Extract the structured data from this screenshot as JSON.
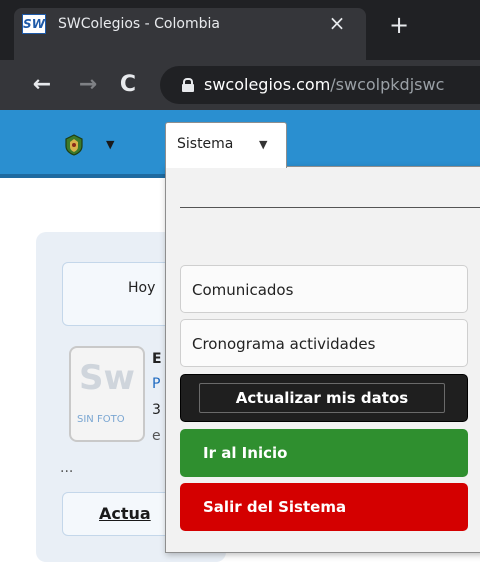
{
  "browser": {
    "favicon_text": "SW",
    "tab_title": "SWColegios - Colombia",
    "tab_close": "×",
    "new_tab": "+",
    "back": "←",
    "forward": "→",
    "reload": "C",
    "url_host": "swcolegios.com",
    "url_path": "/swcolpkdjswc"
  },
  "appbar": {
    "accent_color": "#2a8fd0",
    "logo_icon": "school-crest-icon",
    "logo_caret": "▼"
  },
  "menu": {
    "trigger_label": "Sistema",
    "trigger_caret": "▼",
    "items": [
      {
        "label": "Comunicados"
      },
      {
        "label": "Cronograma actividades"
      },
      {
        "label": "Actualizar mis datos"
      },
      {
        "label": "Ir al Inicio",
        "color": "#2f8f2f"
      },
      {
        "label": "Salir del Sistema",
        "color": "#d40000"
      }
    ]
  },
  "background": {
    "today_text": "Hoy",
    "avatar_logo": "Sw",
    "avatar_caption": "SIN FOTO",
    "fragments": [
      "E",
      "P",
      "3",
      "e"
    ],
    "ellipsis": "...",
    "actua_label": "Actua"
  }
}
